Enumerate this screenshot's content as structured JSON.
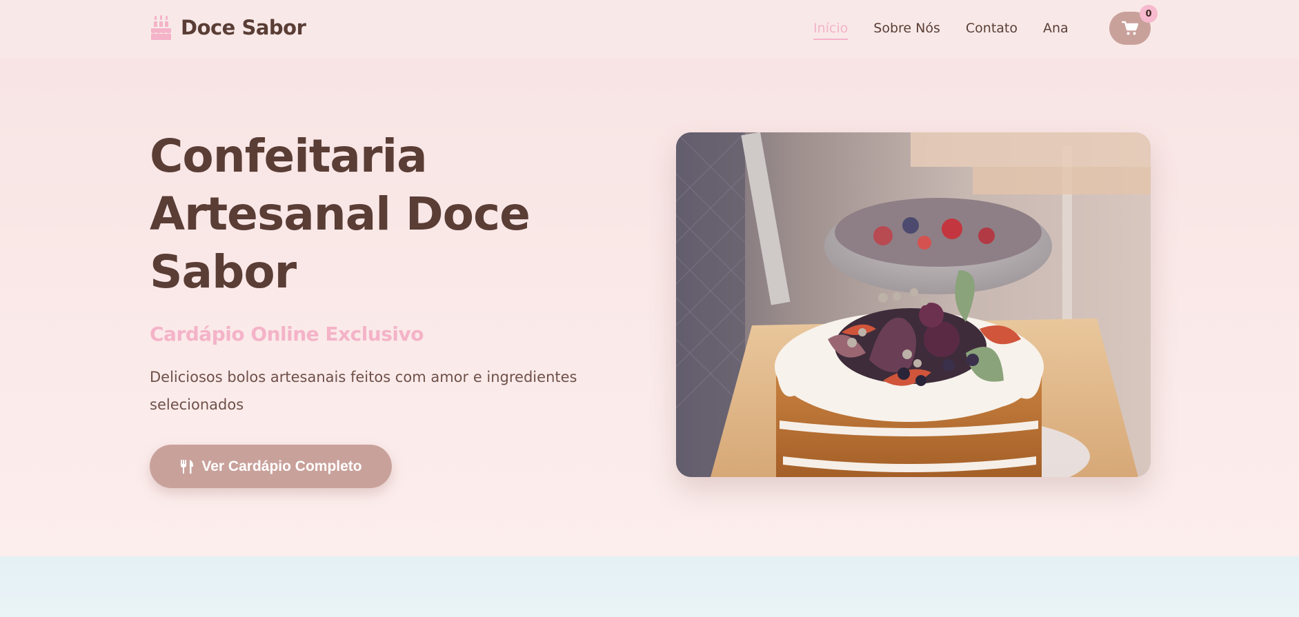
{
  "brand": {
    "name": "Doce Sabor",
    "icon": "birthday-cake-icon"
  },
  "nav": {
    "items": [
      {
        "label": "Início",
        "active": true
      },
      {
        "label": "Sobre Nós",
        "active": false
      },
      {
        "label": "Contato",
        "active": false
      },
      {
        "label": "Ana",
        "active": false
      }
    ]
  },
  "cart": {
    "icon": "shopping-cart-icon",
    "count": "0"
  },
  "hero": {
    "title": "Confeitaria Artesanal Doce Sabor",
    "subtitle": "Cardápio Online Exclusivo",
    "description": "Deliciosos bolos artesanais feitos com amor e ingredientes selecionados",
    "cta_label": "Ver Cardápio Completo",
    "cta_icon": "utensils-icon"
  },
  "colors": {
    "primary_text": "#5a3d35",
    "accent_pink": "#f4b3c8",
    "button_rose": "#c9a19b",
    "hero_background": "#fbeceb",
    "next_section_background": "#e6f2f5"
  }
}
